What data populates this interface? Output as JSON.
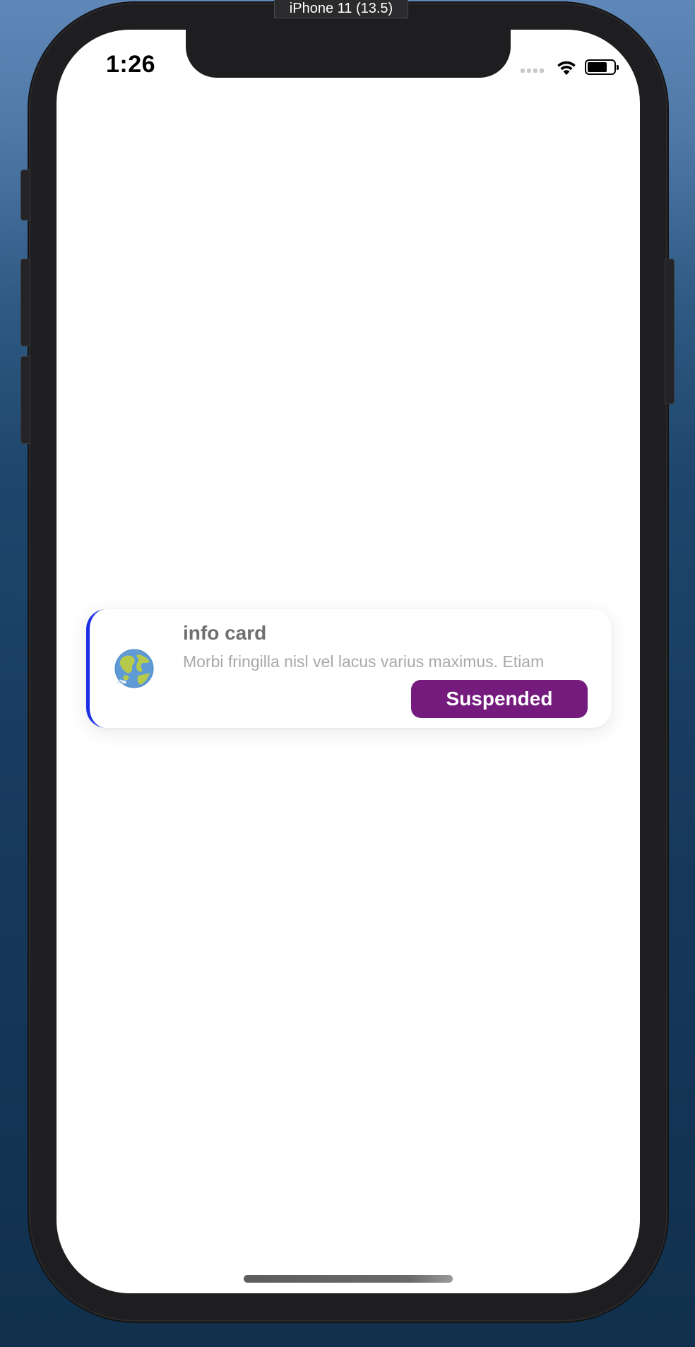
{
  "simulator": {
    "device_label": "iPhone 11 (13.5)"
  },
  "status_bar": {
    "time": "1:26",
    "signal_icon": "cellular-signal-icon",
    "wifi_icon": "wifi-icon",
    "battery_icon": "battery-icon",
    "battery_level": 0.75
  },
  "card": {
    "title": "info card",
    "description": "Morbi fringilla nisl vel lacus varius maximus. Etiam",
    "icon": "globe-icon",
    "status_button_label": "Suspended",
    "accent_color": "#1b2ee6",
    "status_color": "#741b7d"
  }
}
